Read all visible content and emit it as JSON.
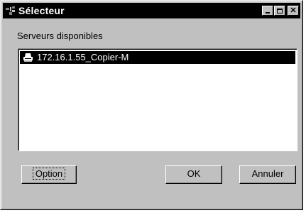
{
  "window": {
    "title": "Sélecteur",
    "controls": {
      "minimize": "minimize",
      "maximize": "maximize",
      "close": "✕"
    }
  },
  "servers": {
    "label": "Serveurs disponibles",
    "items": [
      {
        "name": "172.16.1.55_Copier-M",
        "selected": true,
        "icon": "printer-icon"
      }
    ]
  },
  "buttons": {
    "option": "Option",
    "ok": "OK",
    "cancel": "Annuler"
  }
}
